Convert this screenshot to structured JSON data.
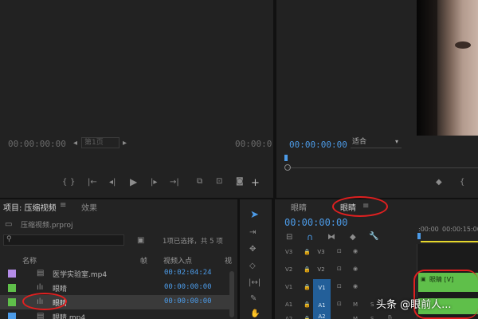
{
  "source_monitor": {
    "timecode_left": "00:00:00:00",
    "timecode_right": "00:00:0",
    "dropdown_label": "第1页"
  },
  "program_monitor": {
    "timecode": "00:00:00:00",
    "fit_label": "适合"
  },
  "project_panel": {
    "title": "项目: 压缩视频",
    "effects_tab": "效果",
    "project_file": "压缩视频.prproj",
    "selection_status": "1项已选择，共 5 项",
    "columns": {
      "name": "名称",
      "frame_rate": "帧",
      "video_in": "视频入点",
      "video_out": "视"
    },
    "items": [
      {
        "name": "医学实验室.mp4",
        "in_point": "00:02:04:24",
        "color": "#b48ce8"
      },
      {
        "name": "眼睛",
        "in_point": "00:00:00:00",
        "color": "#5fbf4a"
      },
      {
        "name": "眼睛",
        "in_point": "00:00:00:00",
        "color": "#5fbf4a"
      },
      {
        "name": "眼睛.mp4",
        "in_point": "",
        "color": "#4c9be8"
      }
    ]
  },
  "timeline": {
    "tab_left": "眼睛",
    "tab_active": "眼睛",
    "timecode": "00:00:00:00",
    "ruler_left": ":00:00",
    "ruler_right": "00:00:15:00",
    "tracks": [
      "V3",
      "V2",
      "V1",
      "A1",
      "A2"
    ],
    "track_targets": [
      "V3",
      "V2",
      "V1",
      "A1",
      "A2"
    ],
    "clip_label": "眼睛 [V]"
  },
  "watermark": "头条 @眼前人..."
}
